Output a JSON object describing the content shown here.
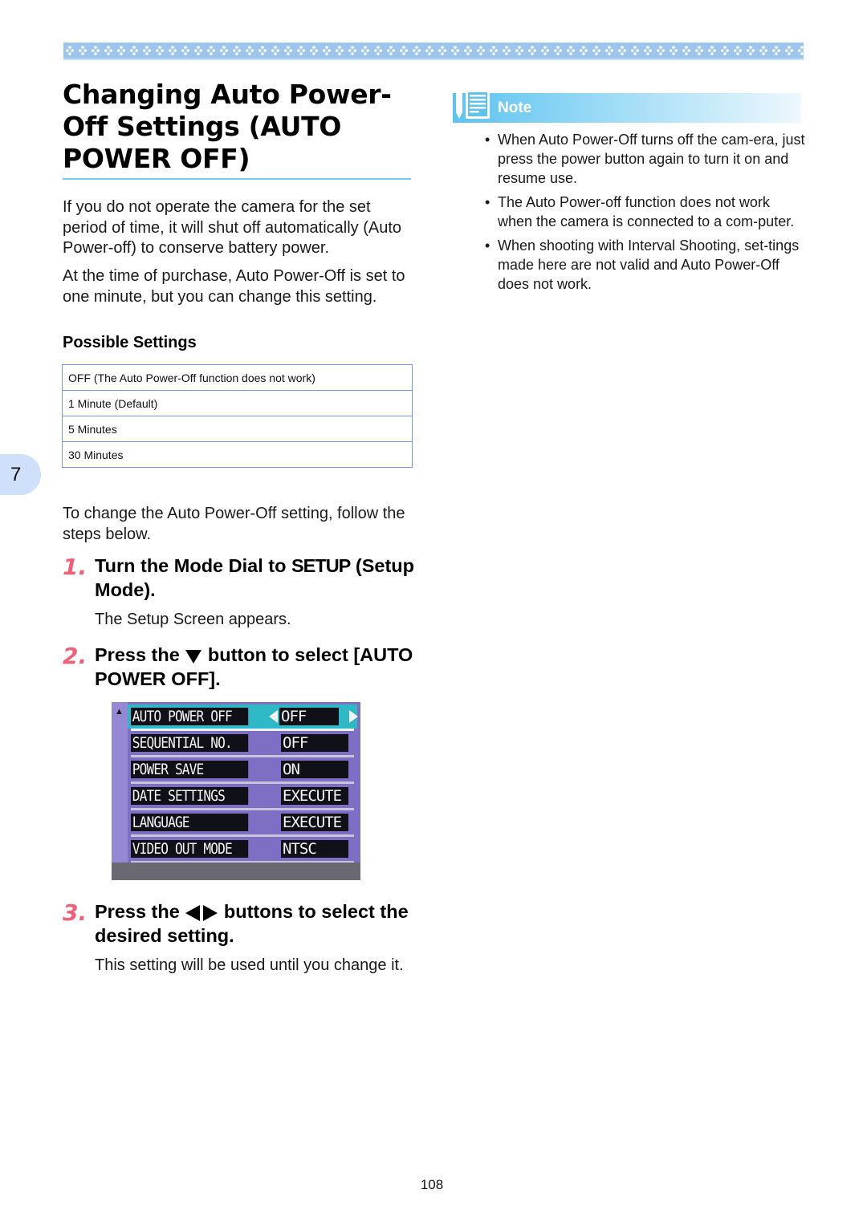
{
  "header": {
    "title": "Changing Auto Power-Off Settings (AUTO POWER OFF)"
  },
  "intro": {
    "paragraph_1": "If you do not operate the camera for the set period of time, it will shut off automatically (Auto Power-off) to conserve battery power.",
    "paragraph_2": "At the time of purchase, Auto Power-Off is set to one minute, but you can change this setting."
  },
  "possible_settings": {
    "heading": "Possible Settings",
    "rows": [
      "OFF (The Auto Power-Off function does not work)",
      "1 Minute (Default)",
      "5 Minutes",
      "30 Minutes"
    ]
  },
  "chapter_tab": {
    "number": "7"
  },
  "instructions_lead": "To change the Auto Power-Off setting, follow the steps below.",
  "steps": [
    {
      "number": "1.",
      "title_pre": "Turn the Mode Dial to ",
      "title_setup": "SETUP",
      "title_post": " (Setup Mode).",
      "body": "The Setup Screen appears."
    },
    {
      "number": "2.",
      "title_pre": "Press the ",
      "icon": "down-triangle-icon",
      "title_post": " button to select [AUTO POWER OFF]."
    },
    {
      "number": "3.",
      "title_pre": "Press the ",
      "icon": "left-right-triangles-icon",
      "title_post": " buttons to select the desired setting.",
      "body": "This setting will be used until you change it."
    }
  ],
  "lcd_screen": {
    "rows": [
      {
        "label": "AUTO POWER OFF",
        "value": "OFF",
        "selected": true
      },
      {
        "label": "SEQUENTIAL NO.",
        "value": "OFF"
      },
      {
        "label": "POWER SAVE",
        "value": "ON"
      },
      {
        "label": "DATE SETTINGS",
        "value": "EXECUTE"
      },
      {
        "label": "LANGUAGE",
        "value": "EXECUTE"
      },
      {
        "label": "VIDEO OUT MODE",
        "value": "NTSC"
      }
    ]
  },
  "note": {
    "label": "Note",
    "icon": "note-pencil-icon",
    "items": [
      "When Auto Power-Off turns off the cam-era, just press the power button again to turn it on and resume use.",
      "The Auto Power-off function does not work when the camera is connected to a com-puter.",
      "When shooting with Interval Shooting, set-tings made here are not valid and Auto Power-Off does not work."
    ]
  },
  "colors": {
    "accent_blue": "#6fd0f2",
    "step_number_pink": "#f0607a",
    "table_border": "#6f9ae6",
    "chapter_tab_bg": "#cfe0fb",
    "lcd_bg": "#7e6ec4",
    "lcd_selected": "#2fb8c6"
  },
  "footer": {
    "page_number": "108"
  }
}
